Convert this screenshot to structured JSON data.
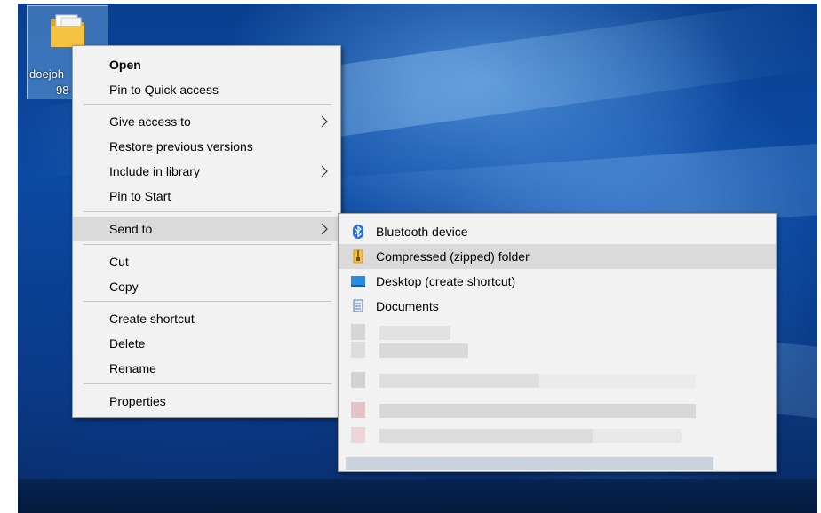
{
  "desktop": {
    "icon_label_line1": "doejoh",
    "icon_label_line2": "98"
  },
  "context_menu": {
    "items": [
      {
        "label": "Open"
      },
      {
        "label": "Pin to Quick access"
      },
      {
        "label": "Give access to"
      },
      {
        "label": "Restore previous versions"
      },
      {
        "label": "Include in library"
      },
      {
        "label": "Pin to Start"
      },
      {
        "label": "Send to"
      },
      {
        "label": "Cut"
      },
      {
        "label": "Copy"
      },
      {
        "label": "Create shortcut"
      },
      {
        "label": "Delete"
      },
      {
        "label": "Rename"
      },
      {
        "label": "Properties"
      }
    ]
  },
  "send_to_menu": {
    "items": [
      {
        "label": "Bluetooth device",
        "icon": "bluetooth-icon"
      },
      {
        "label": "Compressed (zipped) folder",
        "icon": "zip-folder-icon"
      },
      {
        "label": "Desktop (create shortcut)",
        "icon": "desktop-icon"
      },
      {
        "label": "Documents",
        "icon": "documents-icon"
      }
    ]
  },
  "colors": {
    "menu_bg": "#f2f2f2",
    "highlight": "#dadada",
    "bluetooth": "#1e6fd9",
    "folder": "#f5c342"
  }
}
